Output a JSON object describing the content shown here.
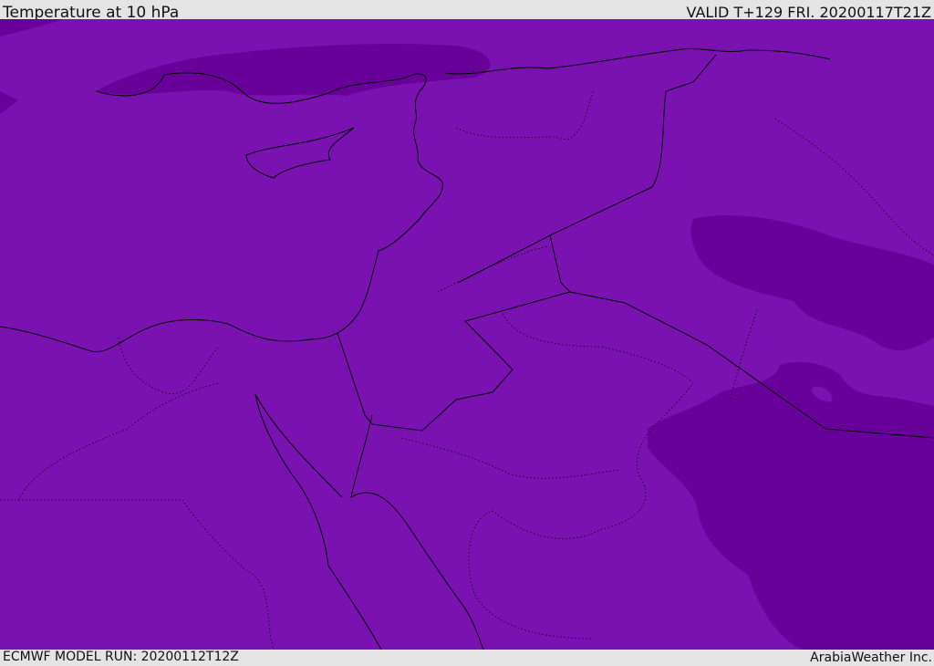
{
  "header": {
    "title": "Temperature at 10 hPa",
    "valid_time": "VALID T+129 FRI. 20200117T21Z"
  },
  "footer": {
    "model_run": "ECMWF MODEL RUN: 20200112T12Z",
    "credit": "ArabiaWeather Inc."
  },
  "map": {
    "colors": {
      "base_fill": "#7a12b2",
      "cold_fill": "#68009a",
      "border": "#000000"
    }
  }
}
